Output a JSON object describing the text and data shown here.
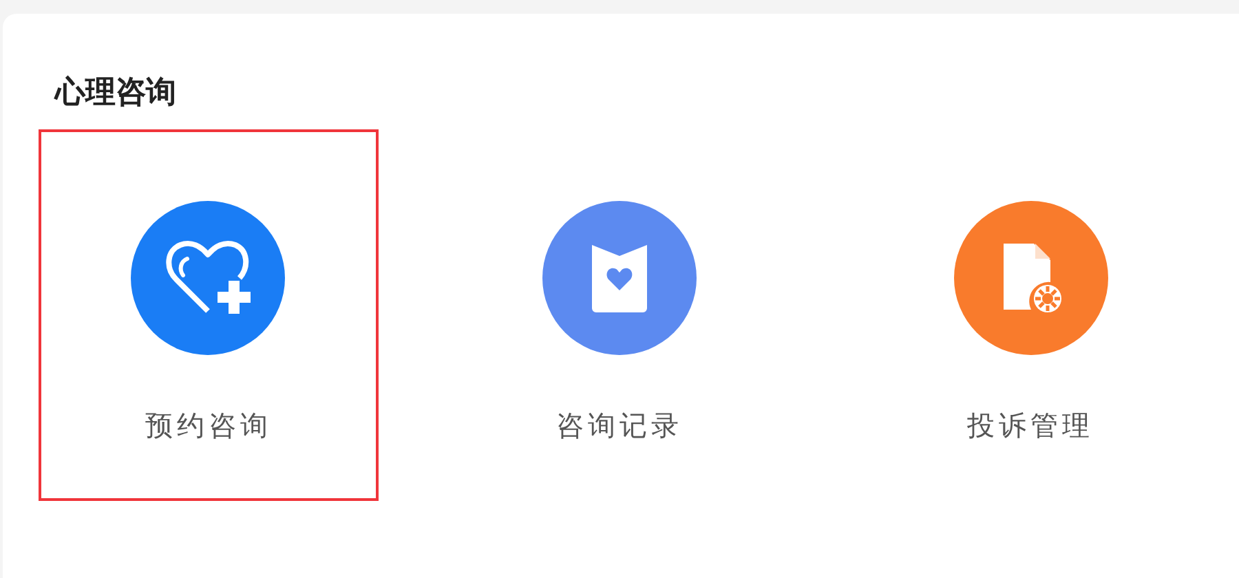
{
  "section": {
    "title": "心理咨询"
  },
  "items": [
    {
      "label": "预约咨询",
      "color": "#1a7df5",
      "selected": true
    },
    {
      "label": "咨询记录",
      "color": "#5c8af0",
      "selected": false
    },
    {
      "label": "投诉管理",
      "color": "#f97b2c",
      "selected": false
    }
  ]
}
